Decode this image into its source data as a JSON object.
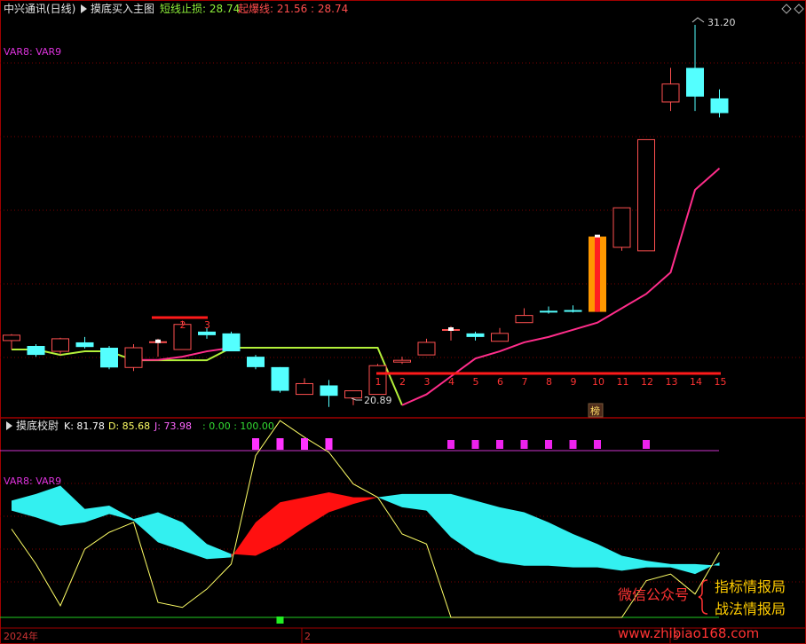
{
  "upper": {
    "stock_name": "中兴通讯(日线)",
    "indicator_name": "摸底买入主图",
    "stop_label": "短线止损: 28.74",
    "burst_label": "起爆线: 21.56 : 28.74",
    "var_label": "VAR8: VAR9",
    "high_label": "31.20",
    "low_label": "20.89",
    "bang_label": "榜"
  },
  "lower": {
    "indicator_name": "摸底校尉",
    "k_label": "K: 81.78",
    "d_label": "D: 85.68",
    "j_label": "J: 73.98",
    "levels_label": ": 0.00 : 100.00",
    "var_label": "VAR8: VAR9"
  },
  "axis": {
    "year_label": "2024年",
    "month2_label": "2",
    "month3_label": "3"
  },
  "watermark": {
    "wechat": "微信公众号",
    "line1": "指标情报局",
    "line2": "战法情报局",
    "site": "www.zhibiao168.com"
  },
  "colors": {
    "up": "#ff5050",
    "down": "#54ffff",
    "stop_line": "#b3f03a",
    "trend": "#ff2d8a",
    "signal_bar": "#ff9800",
    "kdj_j": "#ffff66",
    "level": "#ff33ff",
    "baseline": "#22cc22"
  },
  "counts": {
    "early": [
      "2",
      "3"
    ],
    "main": [
      "1",
      "2",
      "3",
      "4",
      "5",
      "6",
      "7",
      "8",
      "9",
      "10",
      "11",
      "12",
      "13",
      "14",
      "15"
    ]
  },
  "candles": [
    {
      "o": 22.4,
      "c": 22.55,
      "h": 22.58,
      "l": 22.15
    },
    {
      "o": 22.25,
      "c": 22.0,
      "h": 22.3,
      "l": 21.95
    },
    {
      "o": 22.1,
      "c": 22.45,
      "h": 22.48,
      "l": 22.0
    },
    {
      "o": 22.35,
      "c": 22.22,
      "h": 22.5,
      "l": 22.18
    },
    {
      "o": 22.2,
      "c": 21.65,
      "h": 22.25,
      "l": 21.6
    },
    {
      "o": 21.65,
      "c": 22.2,
      "h": 22.3,
      "l": 21.55
    },
    {
      "o": 22.38,
      "c": 22.38,
      "h": 22.45,
      "l": 21.95
    },
    {
      "o": 22.15,
      "c": 22.85,
      "h": 22.95,
      "l": 22.15
    },
    {
      "o": 22.65,
      "c": 22.55,
      "h": 22.75,
      "l": 22.45
    },
    {
      "o": 22.6,
      "c": 22.1,
      "h": 22.65,
      "l": 22.1
    },
    {
      "o": 21.95,
      "c": 21.66,
      "h": 22.0,
      "l": 21.6
    },
    {
      "o": 21.66,
      "c": 21.0,
      "h": 21.66,
      "l": 20.95
    },
    {
      "o": 20.9,
      "c": 21.2,
      "h": 21.35,
      "l": 20.9
    },
    {
      "o": 21.15,
      "c": 20.86,
      "h": 21.3,
      "l": 20.55
    },
    {
      "o": 20.8,
      "c": 21.0,
      "h": 21.0,
      "l": 20.6
    },
    {
      "o": 20.9,
      "c": 21.7,
      "h": 21.75,
      "l": 20.9
    },
    {
      "o": 21.8,
      "c": 21.85,
      "h": 21.95,
      "l": 21.75
    },
    {
      "o": 22.0,
      "c": 22.35,
      "h": 22.45,
      "l": 22.0
    },
    {
      "o": 22.68,
      "c": 22.72,
      "h": 22.8,
      "l": 22.4
    },
    {
      "o": 22.6,
      "c": 22.5,
      "h": 22.65,
      "l": 22.4
    },
    {
      "o": 22.38,
      "c": 22.6,
      "h": 22.75,
      "l": 22.38
    },
    {
      "o": 22.9,
      "c": 23.1,
      "h": 23.3,
      "l": 22.9
    },
    {
      "o": 23.23,
      "c": 23.2,
      "h": 23.35,
      "l": 23.15
    },
    {
      "o": 23.25,
      "c": 23.23,
      "h": 23.38,
      "l": 23.18
    },
    {
      "o": 23.2,
      "c": 25.3,
      "h": 25.3,
      "l": 23.2
    },
    {
      "o": 25.0,
      "c": 26.1,
      "h": 26.1,
      "l": 24.9
    },
    {
      "o": 24.9,
      "c": 28.0,
      "h": 28.0,
      "l": 24.9
    },
    {
      "o": 29.05,
      "c": 29.55,
      "h": 30.0,
      "l": 28.8
    },
    {
      "o": 30.0,
      "c": 29.2,
      "h": 31.2,
      "l": 28.8
    },
    {
      "o": 29.15,
      "c": 28.74,
      "h": 29.4,
      "l": 28.62
    }
  ],
  "stop_line": [
    [
      0,
      22.15
    ],
    [
      1,
      22.15
    ],
    [
      2,
      22.0
    ],
    [
      3,
      22.1
    ],
    [
      4,
      22.1
    ],
    [
      5,
      21.85
    ],
    [
      6,
      21.85
    ],
    [
      7,
      21.85
    ],
    [
      8,
      21.85
    ],
    [
      9,
      22.2
    ],
    [
      10,
      22.2
    ],
    [
      11,
      22.2
    ],
    [
      12,
      22.2
    ],
    [
      13,
      22.2
    ],
    [
      14,
      22.2
    ],
    [
      15,
      22.2
    ],
    [
      16,
      20.6
    ]
  ],
  "trend_line": [
    [
      5,
      21.86
    ],
    [
      6,
      21.86
    ],
    [
      7,
      21.95
    ],
    [
      8,
      22.1
    ],
    [
      9,
      22.2
    ],
    [
      16,
      20.6
    ],
    [
      17,
      20.9
    ],
    [
      18,
      21.4
    ],
    [
      19,
      21.9
    ],
    [
      20,
      22.1
    ],
    [
      21,
      22.35
    ],
    [
      22,
      22.5
    ],
    [
      23,
      22.7
    ],
    [
      24,
      22.9
    ],
    [
      25,
      23.3
    ],
    [
      26,
      23.7
    ],
    [
      27,
      24.3
    ],
    [
      28,
      26.6
    ],
    [
      29,
      27.2
    ]
  ],
  "kdj": {
    "k": [
      64,
      60,
      55,
      57,
      62,
      58,
      45,
      40,
      35,
      36,
      57,
      69,
      72,
      75,
      72,
      72,
      66,
      64,
      48,
      38,
      33,
      31,
      31,
      30,
      30,
      28,
      30,
      30,
      26,
      33
    ],
    "d": [
      70,
      74,
      79,
      65,
      67,
      59,
      63,
      57,
      44,
      38,
      37,
      44,
      54,
      63,
      68,
      72,
      74,
      74,
      74,
      70,
      66,
      63,
      57,
      50,
      44,
      37,
      34,
      32,
      32,
      31
    ],
    "j": [
      53,
      32,
      7,
      41,
      51,
      57,
      9,
      6,
      17,
      32,
      97,
      118,
      108,
      99,
      80,
      72,
      50,
      44,
      0,
      0,
      0,
      0,
      0,
      0,
      0,
      0,
      22,
      26,
      14,
      39
    ]
  },
  "chart_data": [
    {
      "type": "candlestick",
      "title": "摸底买入主图",
      "series": [
        {
          "name": "VAR8: VAR9",
          "values": [
            22.55,
            22.0,
            22.45,
            22.22,
            21.65,
            22.2,
            22.38,
            22.85,
            22.55,
            22.1,
            21.66,
            21.0,
            21.2,
            20.86,
            21.0,
            21.7,
            21.85,
            22.35,
            22.72,
            22.5,
            22.6,
            23.1,
            23.2,
            23.23,
            25.3,
            26.1,
            28.0,
            29.55,
            29.2,
            28.74
          ]
        }
      ],
      "annotations": [
        "31.20",
        "20.89",
        "短线止损: 28.74",
        "起爆线: 21.56 : 28.74"
      ]
    },
    {
      "type": "line",
      "title": "摸底校尉",
      "series": [
        {
          "name": "K",
          "last": 81.78
        },
        {
          "name": "D",
          "last": 85.68
        },
        {
          "name": "J",
          "last": 73.98
        }
      ],
      "levels": [
        0,
        100
      ]
    }
  ]
}
